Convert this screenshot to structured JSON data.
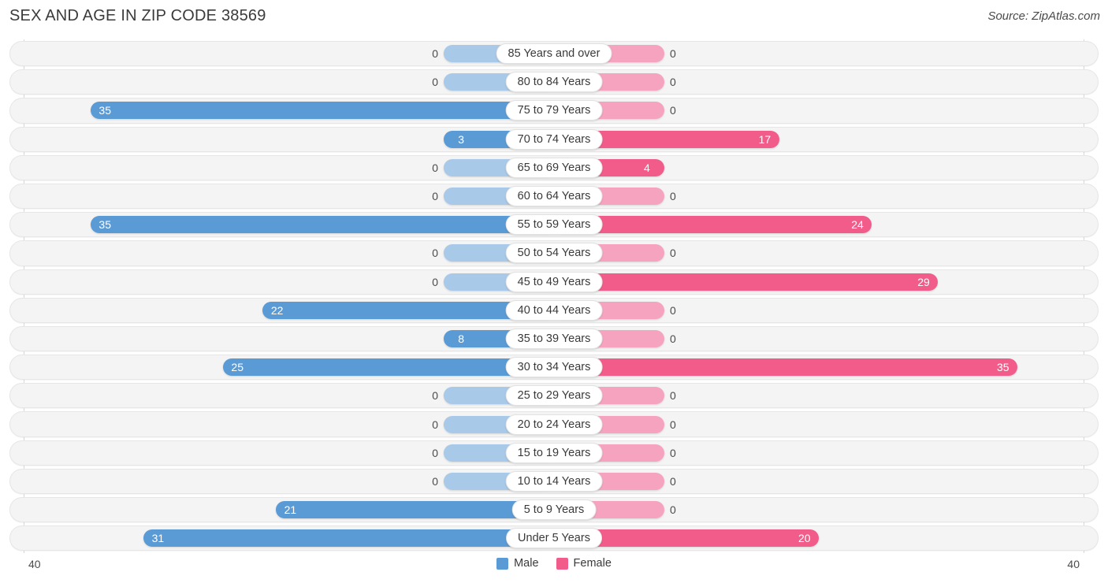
{
  "header": {
    "title": "SEX AND AGE IN ZIP CODE 38569",
    "source": "Source: ZipAtlas.com"
  },
  "axis": {
    "left_tick": "40",
    "right_tick": "40"
  },
  "legend": {
    "items": [
      {
        "label": "Male",
        "color": "#5b9bd5"
      },
      {
        "label": "Female",
        "color": "#f25c8a"
      }
    ]
  },
  "colors": {
    "male_strong": "#5b9bd5",
    "male_light": "#a8c9e8",
    "female_strong": "#f25c8a",
    "female_light": "#f6a3c0",
    "row_bg": "#f4f4f4",
    "row_border": "#e6e6e6",
    "axis_line": "#d8d8d8",
    "text": "#3b3b3b"
  },
  "chart_data": {
    "type": "bar",
    "subtype": "population-pyramid",
    "title": "SEX AND AGE IN ZIP CODE 38569",
    "xlabel": "",
    "ylabel": "",
    "xlim": [
      40,
      40
    ],
    "axis_max": 40,
    "grid": false,
    "legend_position": "bottom-center",
    "categories": [
      "85 Years and over",
      "80 to 84 Years",
      "75 to 79 Years",
      "70 to 74 Years",
      "65 to 69 Years",
      "60 to 64 Years",
      "55 to 59 Years",
      "50 to 54 Years",
      "45 to 49 Years",
      "40 to 44 Years",
      "35 to 39 Years",
      "30 to 34 Years",
      "25 to 29 Years",
      "20 to 24 Years",
      "15 to 19 Years",
      "10 to 14 Years",
      "5 to 9 Years",
      "Under 5 Years"
    ],
    "series": [
      {
        "name": "Male",
        "color": "#5b9bd5",
        "direction": "left",
        "values": [
          0,
          0,
          35,
          3,
          0,
          0,
          35,
          0,
          0,
          22,
          8,
          25,
          0,
          0,
          0,
          0,
          21,
          31
        ]
      },
      {
        "name": "Female",
        "color": "#f25c8a",
        "direction": "right",
        "values": [
          0,
          0,
          0,
          17,
          4,
          0,
          24,
          0,
          29,
          0,
          0,
          35,
          0,
          0,
          0,
          0,
          0,
          20
        ]
      }
    ],
    "rows": [
      {
        "category": "85 Years and over",
        "male": 0,
        "male_label": "0",
        "female": 0,
        "female_label": "0"
      },
      {
        "category": "80 to 84 Years",
        "male": 0,
        "male_label": "0",
        "female": 0,
        "female_label": "0"
      },
      {
        "category": "75 to 79 Years",
        "male": 35,
        "male_label": "35",
        "female": 0,
        "female_label": "0"
      },
      {
        "category": "70 to 74 Years",
        "male": 3,
        "male_label": "3",
        "female": 17,
        "female_label": "17"
      },
      {
        "category": "65 to 69 Years",
        "male": 0,
        "male_label": "0",
        "female": 4,
        "female_label": "4"
      },
      {
        "category": "60 to 64 Years",
        "male": 0,
        "male_label": "0",
        "female": 0,
        "female_label": "0"
      },
      {
        "category": "55 to 59 Years",
        "male": 35,
        "male_label": "35",
        "female": 24,
        "female_label": "24"
      },
      {
        "category": "50 to 54 Years",
        "male": 0,
        "male_label": "0",
        "female": 0,
        "female_label": "0"
      },
      {
        "category": "45 to 49 Years",
        "male": 0,
        "male_label": "0",
        "female": 29,
        "female_label": "29"
      },
      {
        "category": "40 to 44 Years",
        "male": 22,
        "male_label": "22",
        "female": 0,
        "female_label": "0"
      },
      {
        "category": "35 to 39 Years",
        "male": 8,
        "male_label": "8",
        "female": 0,
        "female_label": "0"
      },
      {
        "category": "30 to 34 Years",
        "male": 25,
        "male_label": "25",
        "female": 35,
        "female_label": "35"
      },
      {
        "category": "25 to 29 Years",
        "male": 0,
        "male_label": "0",
        "female": 0,
        "female_label": "0"
      },
      {
        "category": "20 to 24 Years",
        "male": 0,
        "male_label": "0",
        "female": 0,
        "female_label": "0"
      },
      {
        "category": "15 to 19 Years",
        "male": 0,
        "male_label": "0",
        "female": 0,
        "female_label": "0"
      },
      {
        "category": "10 to 14 Years",
        "male": 0,
        "male_label": "0",
        "female": 0,
        "female_label": "0"
      },
      {
        "category": "5 to 9 Years",
        "male": 21,
        "male_label": "21",
        "female": 0,
        "female_label": "0"
      },
      {
        "category": "Under 5 Years",
        "male": 31,
        "male_label": "31",
        "female": 20,
        "female_label": "20"
      }
    ]
  }
}
